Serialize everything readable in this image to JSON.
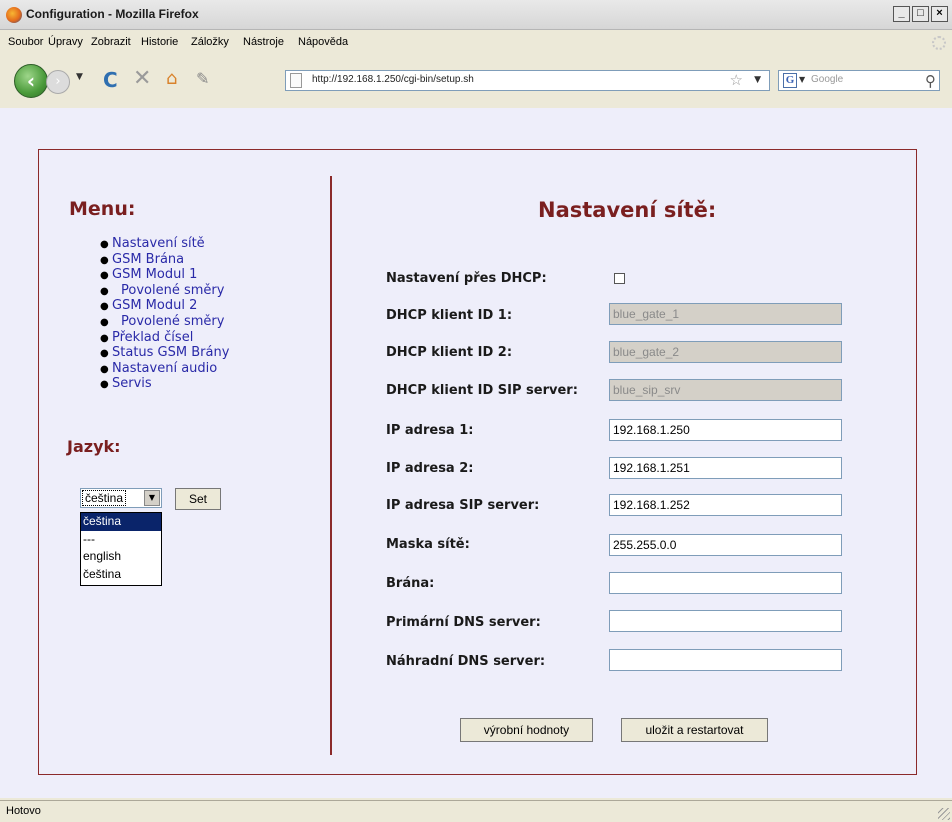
{
  "window": {
    "title": "Configuration - Mozilla Firefox",
    "controls": [
      "_",
      "□",
      "×"
    ]
  },
  "menubar": [
    "Soubor",
    "Úpravy",
    "Zobrazit",
    "Historie",
    "Záložky",
    "Nástroje",
    "Nápověda"
  ],
  "navbar": {
    "url": "http://192.168.1.250/cgi-bin/setup.sh",
    "search_placeholder": "Google"
  },
  "sidebar": {
    "menu_title": "Menu:",
    "items": [
      {
        "label": "Nastavení sítě",
        "sub": false
      },
      {
        "label": "GSM Brána",
        "sub": false
      },
      {
        "label": "GSM Modul 1",
        "sub": false
      },
      {
        "label": "Povolené směry",
        "sub": true
      },
      {
        "label": "GSM Modul 2",
        "sub": false
      },
      {
        "label": "Povolené směry",
        "sub": true
      },
      {
        "label": "Překlad čísel",
        "sub": false
      },
      {
        "label": "Status GSM Brány",
        "sub": false
      },
      {
        "label": "Nastavení audio",
        "sub": false
      },
      {
        "label": "Servis",
        "sub": false
      }
    ],
    "language_title": "Jazyk:",
    "language_selected": "čeština",
    "language_options": [
      "čeština",
      "---",
      "english",
      "čeština"
    ],
    "set_button": "Set"
  },
  "form": {
    "title": "Nastavení sítě:",
    "dhcp_label": "Nastavení přes DHCP:",
    "dhcp_checked": false,
    "fields": [
      {
        "label": "DHCP klient ID 1:",
        "value": "blue_gate_1",
        "disabled": true
      },
      {
        "label": "DHCP klient ID 2:",
        "value": "blue_gate_2",
        "disabled": true
      },
      {
        "label": "DHCP klient ID SIP server:",
        "value": "blue_sip_srv",
        "disabled": true
      },
      {
        "label": "IP adresa 1:",
        "value": "192.168.1.250",
        "disabled": false
      },
      {
        "label": "IP adresa 2:",
        "value": "192.168.1.251",
        "disabled": false
      },
      {
        "label": "IP adresa SIP server:",
        "value": "192.168.1.252",
        "disabled": false
      },
      {
        "label": "Maska sítě:",
        "value": "255.255.0.0",
        "disabled": false
      },
      {
        "label": "Brána:",
        "value": "",
        "disabled": false
      },
      {
        "label": "Primární DNS server:",
        "value": "",
        "disabled": false
      },
      {
        "label": "Náhradní DNS server:",
        "value": "",
        "disabled": false
      }
    ],
    "factory_button": "výrobní hodnoty",
    "save_button": "uložit a restartovat"
  },
  "status": {
    "text": "Hotovo"
  }
}
